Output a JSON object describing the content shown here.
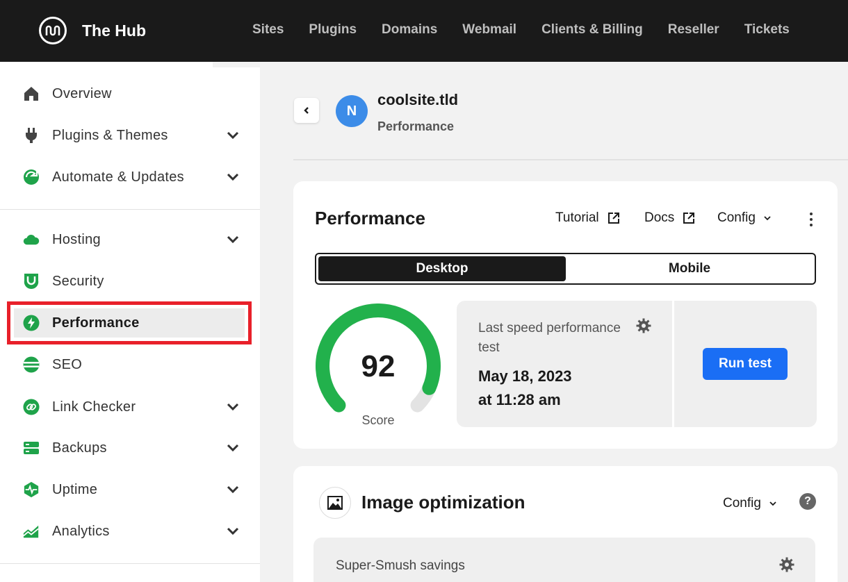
{
  "brand": {
    "title": "The Hub"
  },
  "topnav": [
    "Sites",
    "Plugins",
    "Domains",
    "Webmail",
    "Clients & Billing",
    "Reseller",
    "Tickets"
  ],
  "sidebar": {
    "items": [
      {
        "label": "Overview",
        "icon": "home-icon"
      },
      {
        "label": "Plugins & Themes",
        "icon": "plug-icon",
        "expandable": true
      },
      {
        "label": "Automate & Updates",
        "icon": "automate-icon",
        "expandable": true
      },
      {
        "label": "Hosting",
        "icon": "cloud-icon",
        "expandable": true
      },
      {
        "label": "Security",
        "icon": "shield-icon"
      },
      {
        "label": "Performance",
        "icon": "lightning-icon",
        "active": true
      },
      {
        "label": "SEO",
        "icon": "seo-icon"
      },
      {
        "label": "Link Checker",
        "icon": "link-icon",
        "expandable": true
      },
      {
        "label": "Backups",
        "icon": "backups-icon",
        "expandable": true
      },
      {
        "label": "Uptime",
        "icon": "uptime-icon",
        "expandable": true
      },
      {
        "label": "Analytics",
        "icon": "analytics-icon",
        "expandable": true
      }
    ]
  },
  "site": {
    "avatar_letter": "N",
    "name": "coolsite.tld",
    "section": "Performance"
  },
  "performance": {
    "title": "Performance",
    "tutorial_label": "Tutorial",
    "docs_label": "Docs",
    "config_label": "Config",
    "tabs": {
      "desktop": "Desktop",
      "mobile": "Mobile",
      "selected": "Desktop"
    },
    "score": 92,
    "score_label": "Score",
    "last_test_label": "Last speed performance test",
    "last_test_date": "May 18, 2023",
    "last_test_time": "at 11:28 am",
    "run_test_label": "Run test"
  },
  "image_optimization": {
    "title": "Image optimization",
    "config_label": "Config",
    "help": "?",
    "savings_label": "Super-Smush savings"
  },
  "colors": {
    "topbar": "#1a1a1a",
    "accent_green": "#1fa34a",
    "gauge_green": "#22b14c",
    "primary_button": "#1a6ef5",
    "highlight_red": "#e8202a",
    "avatar_blue": "#3c8ce8"
  }
}
